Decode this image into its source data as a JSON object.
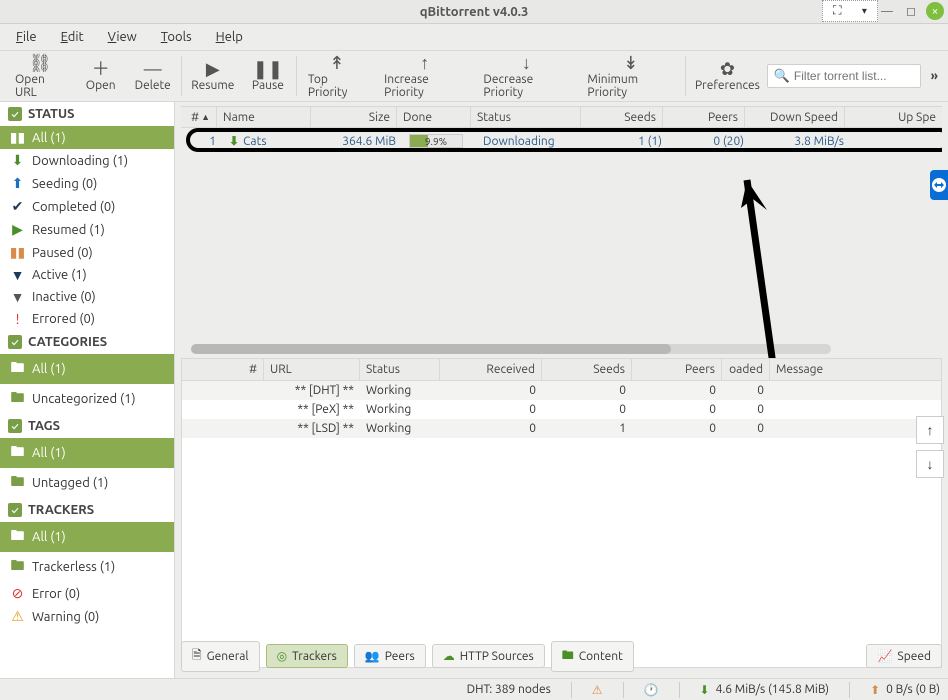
{
  "window": {
    "title": "qBittorrent v4.0.3"
  },
  "menu": {
    "file": "File",
    "edit": "Edit",
    "view": "View",
    "tools": "Tools",
    "help": "Help"
  },
  "toolbar": {
    "open_url": "Open URL",
    "open": "Open",
    "delete": "Delete",
    "resume": "Resume",
    "pause": "Pause",
    "top": "Top Priority",
    "inc": "Increase Priority",
    "dec": "Decrease Priority",
    "min": "Minimum Priority",
    "prefs": "Preferences",
    "filter_placeholder": "Filter torrent list..."
  },
  "sidebar": {
    "status_head": "STATUS",
    "status": [
      {
        "icon": "pause-all",
        "label": "All (1)",
        "sel": true
      },
      {
        "icon": "down-green",
        "label": "Downloading (1)"
      },
      {
        "icon": "up-blue",
        "label": "Seeding (0)"
      },
      {
        "icon": "check-dark",
        "label": "Completed (0)"
      },
      {
        "icon": "play-green",
        "label": "Resumed (1)"
      },
      {
        "icon": "pause-or",
        "label": "Paused (0)"
      },
      {
        "icon": "filter",
        "label": "Active (1)"
      },
      {
        "icon": "filter-dark",
        "label": "Inactive (0)"
      },
      {
        "icon": "err",
        "label": "Errored (0)"
      }
    ],
    "cat_head": "CATEGORIES",
    "cat": [
      {
        "icon": "box",
        "label": "All (1)",
        "sel": true
      },
      {
        "icon": "box",
        "label": "Uncategorized (1)"
      }
    ],
    "tags_head": "TAGS",
    "tags": [
      {
        "icon": "box",
        "label": "All (1)",
        "sel": true
      },
      {
        "icon": "box",
        "label": "Untagged (1)"
      }
    ],
    "trk_head": "TRACKERS",
    "trk": [
      {
        "icon": "box",
        "label": "All (1)",
        "sel": true
      },
      {
        "icon": "box",
        "label": "Trackerless (1)"
      },
      {
        "icon": "stop",
        "label": "Error (0)"
      },
      {
        "icon": "warn",
        "label": "Warning (0)"
      }
    ]
  },
  "columns": {
    "num": "#",
    "name": "Name",
    "size": "Size",
    "done": "Done",
    "status": "Status",
    "seeds": "Seeds",
    "peers": "Peers",
    "down": "Down Speed",
    "up": "Up Spe"
  },
  "torrent": {
    "num": "1",
    "name": "Cats",
    "size": "364.6 MiB",
    "done": "9.9%",
    "done_pct": 35,
    "status": "Downloading",
    "seeds": "1 (1)",
    "peers": "0 (20)",
    "down": "3.8 MiB/s"
  },
  "tk_cols": {
    "num": "#",
    "url": "URL",
    "status": "Status",
    "recv": "Received",
    "seeds": "Seeds",
    "peers": "Peers",
    "loaded": "oaded",
    "msg": "Message"
  },
  "trackers": [
    {
      "url": "** [DHT] **",
      "status": "Working",
      "recv": "0",
      "seeds": "0",
      "peers": "0",
      "dl": "0"
    },
    {
      "url": "** [PeX] **",
      "status": "Working",
      "recv": "0",
      "seeds": "0",
      "peers": "0",
      "dl": "0"
    },
    {
      "url": "** [LSD] **",
      "status": "Working",
      "recv": "0",
      "seeds": "1",
      "peers": "0",
      "dl": "0"
    }
  ],
  "tabs": {
    "general": "General",
    "trackers": "Trackers",
    "peers": "Peers",
    "http": "HTTP Sources",
    "content": "Content",
    "speed": "Speed"
  },
  "status": {
    "dht": "DHT: 389 nodes",
    "dl": "4.6 MiB/s (145.8 MiB)",
    "ul": "0 B/s (0 B)"
  }
}
